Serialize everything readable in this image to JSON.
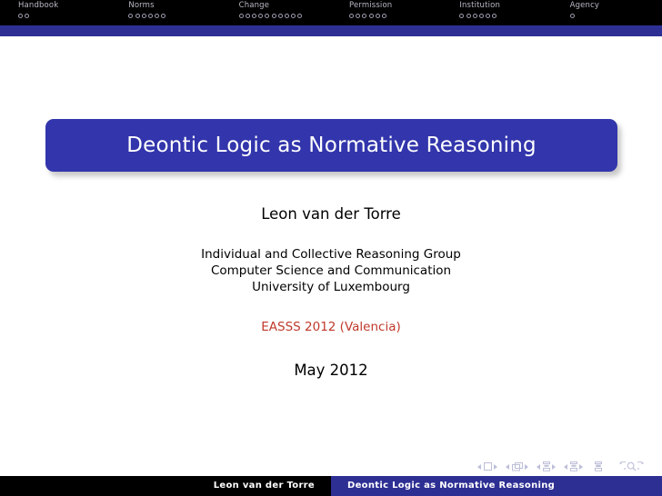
{
  "slide": {
    "type": "beamer-title-slide"
  },
  "headnav": {
    "sections": [
      {
        "label": "Handbook",
        "dots": 2
      },
      {
        "label": "Norms",
        "dots": 6
      },
      {
        "label": "Change",
        "dots": 10
      },
      {
        "label": "Permission",
        "dots": 6
      },
      {
        "label": "Institution",
        "dots": 6
      },
      {
        "label": "Agency",
        "dots": 1
      }
    ]
  },
  "title": {
    "text": "Deontic Logic as Normative Reasoning",
    "banner_color": "#3235ab",
    "text_color": "#ffffff"
  },
  "author": {
    "name": "Leon van der Torre"
  },
  "affiliation": {
    "lines": [
      "Individual and Collective Reasoning Group",
      "Computer Science and Communication",
      "University of Luxembourg"
    ]
  },
  "venue": {
    "text": "EASSS 2012 (Valencia)",
    "color": "#cc4444"
  },
  "date": {
    "text": "May 2012"
  },
  "navsymbols": {
    "color": "#b9bcd6",
    "groups": [
      {
        "icon": "slide-icon",
        "prev": "◂",
        "next": "▸"
      },
      {
        "icon": "frame-icon",
        "prev": "◂",
        "next": "▸"
      },
      {
        "icon": "subsection-icon",
        "prev": "◂",
        "next": "▸"
      },
      {
        "icon": "section-icon",
        "prev": "◂",
        "next": "▸"
      }
    ],
    "doc_icon": "document-icon",
    "back_icon": "back-icon",
    "search_icon": "search-icon",
    "forward_icon": "forward-icon"
  },
  "footer": {
    "left_text": "Leon van der Torre",
    "right_text": "Deontic Logic as Normative Reasoning",
    "left_bg": "#000000",
    "right_bg": "#2e2f93"
  }
}
